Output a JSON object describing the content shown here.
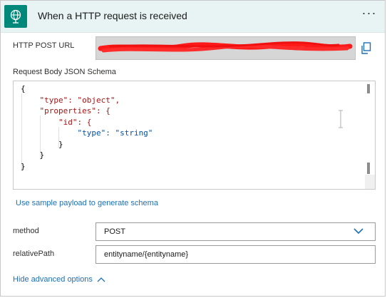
{
  "header": {
    "title": "When a HTTP request is received",
    "more_label": "···"
  },
  "http_post_url": {
    "label": "HTTP POST URL"
  },
  "schema": {
    "label": "Request Body JSON Schema",
    "code_lines": [
      "{",
      "    \"type\": \"object\",",
      "    \"properties\": {",
      "        \"id\": {",
      "            \"type\": \"string\"",
      "        }",
      "    }",
      "}"
    ]
  },
  "sample_payload_link": "Use sample payload to generate schema",
  "method": {
    "label": "method",
    "value": "POST"
  },
  "relative_path": {
    "label": "relativePath",
    "value": "entityname/{entityname}"
  },
  "hide_advanced": "Hide advanced options",
  "icons": {
    "trigger": "globe-request-icon",
    "copy": "copy-icon",
    "chevron": "chevron-down-icon",
    "collapse": "chevron-up-icon"
  },
  "colors": {
    "header_bg": "#e8f4f3",
    "icon_bg": "#00897b",
    "link": "#1f6fb5",
    "redaction": "#ff1a1a"
  }
}
